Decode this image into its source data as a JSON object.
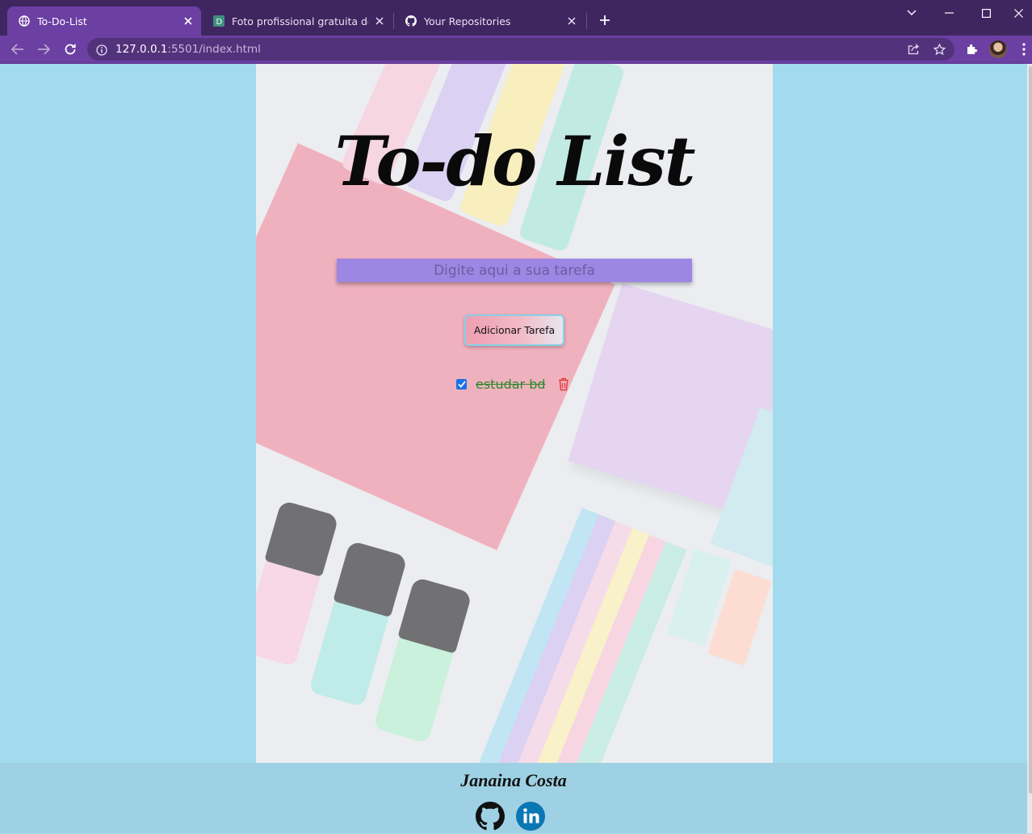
{
  "browser": {
    "tabs": [
      {
        "label": "To-Do-List",
        "active": true
      },
      {
        "label": "Foto profissional gratuita de arra",
        "active": false
      },
      {
        "label": "Your Repositories",
        "active": false
      }
    ],
    "url_host": "127.0.0.1",
    "url_rest": ":5501/index.html",
    "accent_color": "#6c3fa3"
  },
  "app": {
    "title": "To-do List",
    "input_placeholder": "Digite aqui a sua tarefa",
    "add_button_label": "Adicionar Tarefa",
    "tasks": [
      {
        "text": "estudar bd",
        "done": true
      }
    ]
  },
  "footer": {
    "author": "Janaina Costa",
    "icons": [
      "github-icon",
      "linkedin-icon"
    ]
  }
}
